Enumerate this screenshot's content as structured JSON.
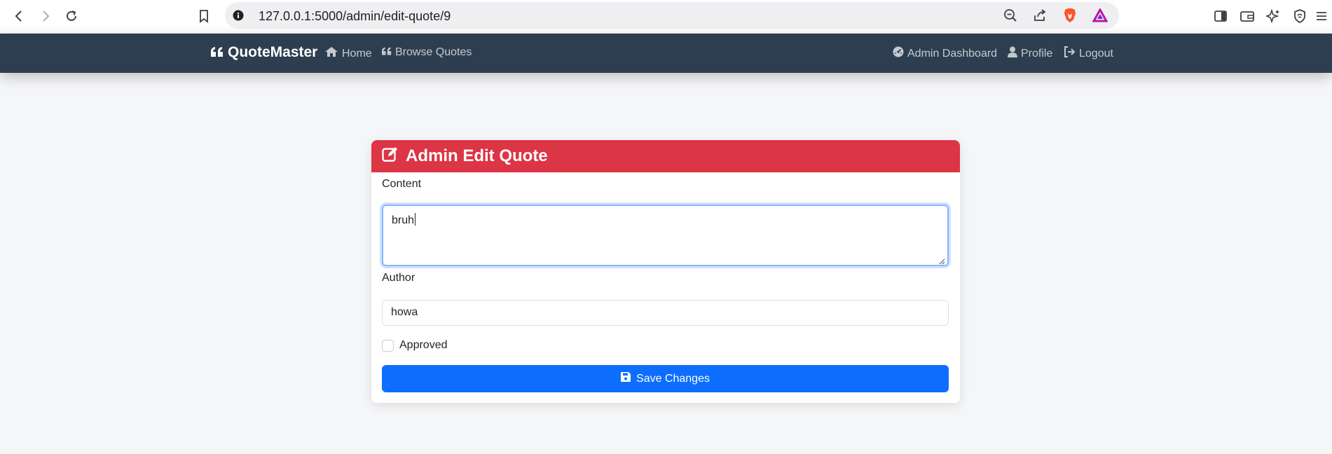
{
  "browser": {
    "url": "127.0.0.1:5000/admin/edit-quote/9",
    "icons": [
      "back-icon",
      "forward-icon",
      "reload-icon",
      "bookmark-icon",
      "site-info-icon",
      "zoom-icon",
      "share-icon",
      "brave-shield-icon",
      "brave-rewards-icon",
      "sidebar-icon",
      "wallet-icon",
      "leo-ai-icon",
      "vpn-icon",
      "menu-icon"
    ]
  },
  "navbar": {
    "brand": "QuoteMaster",
    "left_links": [
      {
        "label": "Home",
        "icon": "home-icon"
      },
      {
        "label": "Browse Quotes",
        "icon": "quote-icon"
      }
    ],
    "right_links": [
      {
        "label": "Admin Dashboard",
        "icon": "dashboard-icon"
      },
      {
        "label": "Profile",
        "icon": "user-icon"
      },
      {
        "label": "Logout",
        "icon": "logout-icon"
      }
    ]
  },
  "form": {
    "title": "Admin Edit Quote",
    "content_label": "Content",
    "content_value": "bruh",
    "author_label": "Author",
    "author_value": "howa",
    "approved_label": "Approved",
    "approved": false,
    "save_label": "Save Changes"
  },
  "colors": {
    "navbar": "#2d3e50",
    "header": "#dc3545",
    "primary": "#0d6efd",
    "background": "#f5f6f8"
  }
}
